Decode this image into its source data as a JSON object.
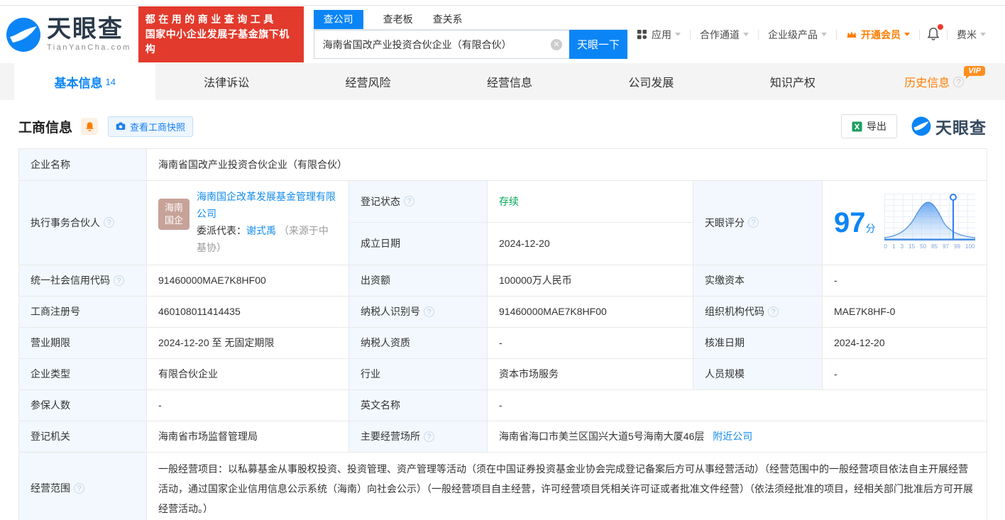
{
  "header": {
    "logo": {
      "cn": "天眼查",
      "en": "TianYanCha.com"
    },
    "slogan": {
      "line1": "都在用的商业查询工具",
      "line2": "国家中小企业发展子基金旗下机构"
    },
    "search": {
      "tabs": [
        {
          "label": "查公司",
          "active": true
        },
        {
          "label": "查老板",
          "active": false
        },
        {
          "label": "查关系",
          "active": false
        }
      ],
      "value": "海南省国改产业投资合伙企业（有限合伙）",
      "button": "天眼一下"
    },
    "nav": {
      "apps": "应用",
      "partner_channel": "合作通道",
      "enterprise_product": "企业级产品",
      "vip": "开通会员",
      "user": "费米"
    }
  },
  "tabs": {
    "basic": {
      "label": "基本信息",
      "count": "14"
    },
    "legal": {
      "label": "法律诉讼"
    },
    "risk": {
      "label": "经营风险"
    },
    "operation": {
      "label": "经营信息"
    },
    "development": {
      "label": "公司发展"
    },
    "ip": {
      "label": "知识产权"
    },
    "history": {
      "label": "历史信息",
      "vip_badge": "VIP"
    }
  },
  "section": {
    "title": "工商信息",
    "snapshot_button": "查看工商快照",
    "export_button": "导出",
    "watermark": "天眼查"
  },
  "biz": {
    "company_name": {
      "label": "企业名称",
      "value": "海南省国改产业投资合伙企业（有限合伙）"
    },
    "partner": {
      "label": "执行事务合伙人",
      "avatar_line1": "海南",
      "avatar_line2": "国企",
      "company": "海南国企改革发展基金管理有限公司",
      "delegate_label": "委派代表：",
      "delegate_name": "谢式禹",
      "delegate_source": "（来源于中基协）"
    },
    "reg_status": {
      "label": "登记状态",
      "value": "存续"
    },
    "establish_date": {
      "label": "成立日期",
      "value": "2024-12-20"
    },
    "score": {
      "label": "天眼评分",
      "value": "97",
      "unit": "分",
      "axis": [
        "0",
        "1",
        "3",
        "15",
        "50",
        "85",
        "97",
        "99",
        "100"
      ]
    },
    "credit_code": {
      "label": "统一社会信用代码",
      "value": "91460000MAE7K8HF00"
    },
    "contribution": {
      "label": "出资额",
      "value": "100000万人民币"
    },
    "paid_capital": {
      "label": "实缴资本",
      "value": "-"
    },
    "reg_number": {
      "label": "工商注册号",
      "value": "460108011414435"
    },
    "taxpayer_id": {
      "label": "纳税人识别号",
      "value": "91460000MAE7K8HF00"
    },
    "org_code": {
      "label": "组织机构代码",
      "value": "MAE7K8HF-0"
    },
    "business_term": {
      "label": "营业期限",
      "value": "2024-12-20 至 无固定期限"
    },
    "taxpayer_quality": {
      "label": "纳税人资质",
      "value": "-"
    },
    "approval_date": {
      "label": "核准日期",
      "value": "2024-12-20"
    },
    "company_type": {
      "label": "企业类型",
      "value": "有限合伙企业"
    },
    "industry": {
      "label": "行业",
      "value": "资本市场服务"
    },
    "staff_size": {
      "label": "人员规模",
      "value": "-"
    },
    "insured_count": {
      "label": "参保人数",
      "value": "-"
    },
    "english_name": {
      "label": "英文名称",
      "value": "-"
    },
    "reg_authority": {
      "label": "登记机关",
      "value": "海南省市场监督管理局"
    },
    "business_site": {
      "label": "主要经营场所",
      "value": "海南省海口市美兰区国兴大道5号海南大厦46层",
      "link": "附近公司"
    },
    "business_scope": {
      "label": "经营范围",
      "value": "一般经营项目：以私募基金从事股权投资、投资管理、资产管理等活动（须在中国证券投资基金业协会完成登记备案后方可从事经营活动）（经营范围中的一般经营项目依法自主开展经营活动，通过国家企业信用信息公示系统（海南）向社会公示）（一般经营项目自主经营，许可经营项目凭相关许可证或者批准文件经营）（依法须经批准的项目，经相关部门批准后方可开展经营活动。）"
    }
  }
}
